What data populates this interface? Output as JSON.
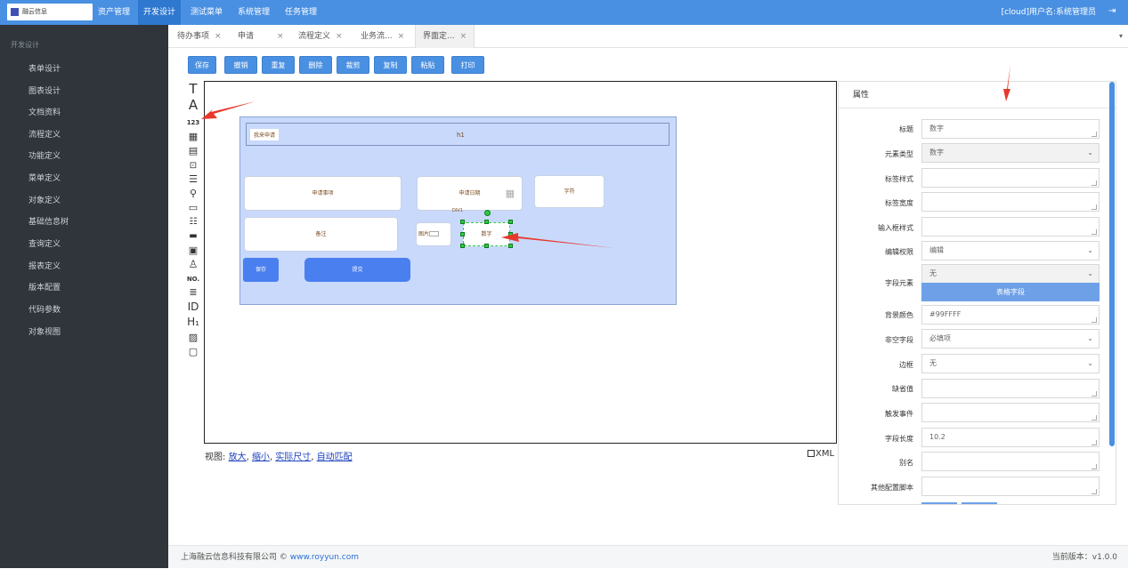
{
  "app": {
    "logo_text": "融云信息",
    "user_info": "[cloud]用户名:系统管理员"
  },
  "topnav": [
    {
      "label": "资产管理"
    },
    {
      "label": "开发设计"
    },
    {
      "label": "测试菜单"
    },
    {
      "label": "系统管理"
    },
    {
      "label": "任务管理"
    }
  ],
  "sidebar": {
    "title": "开发设计",
    "items": [
      {
        "label": "表单设计"
      },
      {
        "label": "图表设计"
      },
      {
        "label": "文档资料"
      },
      {
        "label": "流程定义"
      },
      {
        "label": "功能定义"
      },
      {
        "label": "菜单定义"
      },
      {
        "label": "对象定义"
      },
      {
        "label": "基础信息树"
      },
      {
        "label": "查询定义"
      },
      {
        "label": "报表定义"
      },
      {
        "label": "版本配置"
      },
      {
        "label": "代码参数"
      },
      {
        "label": "对象视图"
      }
    ]
  },
  "tabs": [
    {
      "label": "待办事项",
      "close": "×"
    },
    {
      "label": "申请",
      "close": "×"
    },
    {
      "label": "流程定义",
      "close": "×"
    },
    {
      "label": "业务流...",
      "close": "×"
    },
    {
      "label": "界面定...",
      "close": "×"
    }
  ],
  "toolbar": [
    {
      "label": "保存"
    },
    {
      "label": "撤销"
    },
    {
      "label": "重复"
    },
    {
      "label": "删除"
    },
    {
      "label": "裁剪"
    },
    {
      "label": "复制"
    },
    {
      "label": "粘贴"
    },
    {
      "label": "打印"
    }
  ],
  "palette": [
    {
      "glyph": "T",
      "icon": "text-icon"
    },
    {
      "glyph": "A",
      "icon": "label-icon"
    },
    {
      "glyph": "123",
      "icon": "number-icon"
    },
    {
      "glyph": "▦",
      "icon": "calendar-icon"
    },
    {
      "glyph": "▤",
      "icon": "table-icon"
    },
    {
      "glyph": "⊡",
      "icon": "tree-icon"
    },
    {
      "glyph": "☰",
      "icon": "list-icon"
    },
    {
      "glyph": "⚲",
      "icon": "attachment-icon"
    },
    {
      "glyph": "▭",
      "icon": "textarea-icon"
    },
    {
      "glyph": "☷",
      "icon": "checklist-icon"
    },
    {
      "glyph": "▬",
      "icon": "html-icon"
    },
    {
      "glyph": "▣",
      "icon": "datebox-icon"
    },
    {
      "glyph": "♙",
      "icon": "user-icon"
    },
    {
      "glyph": "NO.",
      "icon": "serial-number-icon"
    },
    {
      "glyph": "≣",
      "icon": "document-icon"
    },
    {
      "glyph": "ID",
      "icon": "id-icon"
    },
    {
      "glyph": "H₁",
      "icon": "heading-icon"
    },
    {
      "glyph": "▨",
      "icon": "image-icon"
    },
    {
      "glyph": "▢",
      "icon": "div-icon"
    }
  ],
  "form": {
    "title_tag": "我来申请",
    "header": "h1",
    "field_apply_item": "申请事项",
    "field_apply_date": "申请日期",
    "field_text": "字符",
    "field_remark": "备注",
    "field_image": "图片",
    "field_number": "数字",
    "div_tag": "DIV1",
    "btn_save": "保存",
    "btn_submit": "提交"
  },
  "viewbar": {
    "prefix": "视图:",
    "zoom_in": "放大",
    "zoom_out": "缩小",
    "actual_size": "实际尺寸",
    "auto_fit": "自动匹配",
    "sep": ",",
    "xml_label": "XML"
  },
  "props": {
    "title": "属性",
    "rows": [
      {
        "label": "标题",
        "value": "数字",
        "kind": "textarea"
      },
      {
        "label": "元素类型",
        "value": "数字",
        "kind": "select-grey"
      },
      {
        "label": "标签样式",
        "value": "",
        "kind": "textarea"
      },
      {
        "label": "标签宽度",
        "value": "",
        "kind": "textarea"
      },
      {
        "label": "输入框样式",
        "value": "",
        "kind": "textarea"
      },
      {
        "label": "编辑权限",
        "value": "编辑",
        "kind": "select"
      },
      {
        "label": "字段元素",
        "value": "无",
        "kind": "select-grey"
      },
      {
        "label": "背景颜色",
        "value": "#99FFFF",
        "kind": "textarea"
      },
      {
        "label": "非空字段",
        "value": "必填项",
        "kind": "select"
      },
      {
        "label": "边框",
        "value": "无",
        "kind": "select"
      },
      {
        "label": "缺省值",
        "value": "",
        "kind": "textarea"
      },
      {
        "label": "触发事件",
        "value": "",
        "kind": "textarea"
      },
      {
        "label": "字段长度",
        "value": "10.2",
        "kind": "textarea"
      },
      {
        "label": "别名",
        "value": "",
        "kind": "textarea"
      },
      {
        "label": "其他配置脚本",
        "value": "",
        "kind": "textarea"
      }
    ],
    "table_field_button": "表格字段"
  },
  "footer": {
    "company": "上海融云信息科技有限公司 ©",
    "url": "www.royyun.com",
    "version": "当前版本：v1.0.0"
  },
  "colors": {
    "topbar": "#4a90e2",
    "sidebar": "#2f353b",
    "canvas_form_bg": "#c9d9fb",
    "selection_handle": "#2ecc40",
    "annotation_arrow": "#e8382d"
  }
}
